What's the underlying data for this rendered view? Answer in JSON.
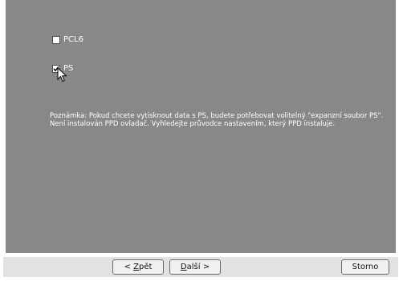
{
  "options": [
    {
      "label": "PCL6",
      "checked": false
    },
    {
      "label": "PS",
      "checked": true
    }
  ],
  "note": "Poznámka: Pokud chcete vytisknout data s PS, budete potřebovat volitelný \"expanzní soubor PS\". Není instalován PPD ovladač. Vyhledejte průvodce nastavením, který PPD instaluje.",
  "buttons": {
    "back": {
      "prefix": "< ",
      "mnemonic": "Z",
      "rest": "pět"
    },
    "next": {
      "mnemonic": "D",
      "rest": "alší",
      "suffix": " >"
    },
    "cancel": "Storno"
  },
  "icons": {
    "checkmark": "checkmark-icon",
    "cursor": "mouse-pointer-icon"
  }
}
